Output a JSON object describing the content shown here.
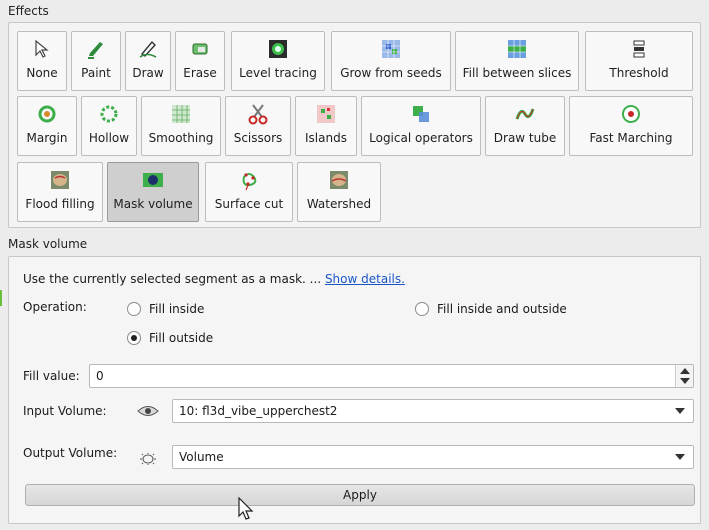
{
  "effects": {
    "title": "Effects",
    "tiles": [
      {
        "label": "None",
        "icon": "cursor-arrow-icon"
      },
      {
        "label": "Paint",
        "icon": "paint-brush-icon"
      },
      {
        "label": "Draw",
        "icon": "pen-draw-icon"
      },
      {
        "label": "Erase",
        "icon": "eraser-icon"
      },
      {
        "label": "Level tracing",
        "icon": "level-tracing-icon"
      },
      {
        "label": "Grow from seeds",
        "icon": "grow-seeds-icon"
      },
      {
        "label": "Fill between slices",
        "icon": "fill-slices-icon"
      },
      {
        "label": "Threshold",
        "icon": "threshold-icon"
      },
      {
        "label": "Margin",
        "icon": "margin-icon"
      },
      {
        "label": "Hollow",
        "icon": "hollow-icon"
      },
      {
        "label": "Smoothing",
        "icon": "smoothing-icon"
      },
      {
        "label": "Scissors",
        "icon": "scissors-icon"
      },
      {
        "label": "Islands",
        "icon": "islands-icon"
      },
      {
        "label": "Logical operators",
        "icon": "logical-operators-icon"
      },
      {
        "label": "Draw tube",
        "icon": "draw-tube-icon"
      },
      {
        "label": "Fast Marching",
        "icon": "fast-marching-icon"
      },
      {
        "label": "Flood filling",
        "icon": "flood-filling-icon"
      },
      {
        "label": "Mask volume",
        "icon": "mask-volume-icon"
      },
      {
        "label": "Surface cut",
        "icon": "surface-cut-icon"
      },
      {
        "label": "Watershed",
        "icon": "watershed-icon"
      }
    ],
    "selected": "Mask volume"
  },
  "mask": {
    "title": "Mask volume",
    "description": "Use the currently selected segment as a mask. ...",
    "show_details": "Show details.",
    "operation_label": "Operation:",
    "options": {
      "fill_inside": "Fill inside",
      "fill_outside": "Fill outside",
      "fill_inside_outside": "Fill inside and outside"
    },
    "selected_option": "Fill outside",
    "fill_value_label": "Fill value:",
    "fill_value": "0",
    "input_volume_label": "Input Volume:",
    "input_volume": "10: fl3d_vibe_upperchest2",
    "output_volume_label": "Output Volume:",
    "output_volume": "Volume",
    "apply_label": "Apply"
  },
  "colors": {
    "accent_link": "#1a55c8",
    "selected_tile": "#cfcfcf"
  }
}
